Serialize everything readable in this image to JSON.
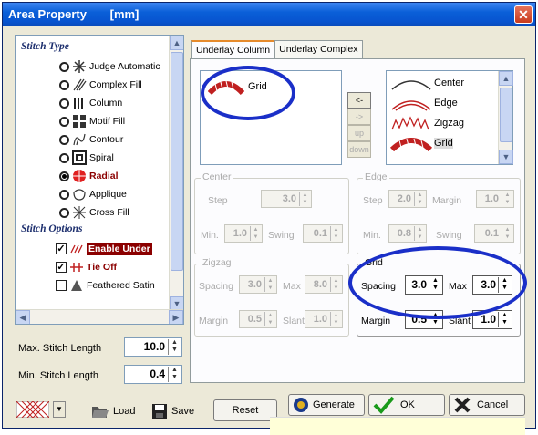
{
  "window": {
    "title": "Area Property",
    "unit": "[mm]",
    "close_label": "✕"
  },
  "stitch_list": {
    "section_type": "Stitch Type",
    "section_options": "Stitch Options",
    "types": [
      {
        "label": "Judge Automatic",
        "selected": false
      },
      {
        "label": "Complex Fill",
        "selected": false
      },
      {
        "label": "Column",
        "selected": false
      },
      {
        "label": "Motif Fill",
        "selected": false
      },
      {
        "label": "Contour",
        "selected": false
      },
      {
        "label": "Spiral",
        "selected": false
      },
      {
        "label": "Radial",
        "selected": true
      },
      {
        "label": "Applique",
        "selected": false
      },
      {
        "label": "Cross Fill",
        "selected": false
      }
    ],
    "options": [
      {
        "label": "Enable Under",
        "checked": true
      },
      {
        "label": "Tie Off",
        "checked": true
      },
      {
        "label": "Feathered Satin",
        "checked": false
      }
    ]
  },
  "fields": {
    "max_stitch_label": "Max. Stitch Length",
    "max_stitch_value": "10.0",
    "min_stitch_label": "Min. Stitch Length",
    "min_stitch_value": "0.4"
  },
  "tabs": [
    "Underlay Column",
    "Underlay Complex"
  ],
  "underlay": {
    "selected_items": [
      "Grid"
    ],
    "available_items": [
      "Center",
      "Edge",
      "Zigzag",
      "Grid"
    ],
    "move_buttons": [
      "<-",
      "->",
      "up",
      "down"
    ]
  },
  "center": {
    "title": "Center",
    "step_label": "Step",
    "step": "3.0",
    "min_label": "Min.",
    "min": "1.0",
    "swing_label": "Swing",
    "swing": "0.1"
  },
  "edge": {
    "title": "Edge",
    "step_label": "Step",
    "step": "2.0",
    "margin_label": "Margin",
    "margin": "1.0",
    "min_label": "Min.",
    "min": "0.8",
    "swing_label": "Swing",
    "swing": "0.1"
  },
  "zigzag": {
    "title": "Zigzag",
    "spacing_label": "Spacing",
    "spacing": "3.0",
    "max_label": "Max",
    "max": "8.0",
    "margin_label": "Margin",
    "margin": "0.5",
    "slant_label": "Slant",
    "slant": "1.0"
  },
  "grid": {
    "title": "Grid",
    "spacing_label": "Spacing",
    "spacing": "3.0",
    "max_label": "Max",
    "max": "3.0",
    "margin_label": "Margin",
    "margin": "0.5",
    "slant_label": "Slant",
    "slant": "1.0"
  },
  "toolbar": {
    "load": "Load",
    "save": "Save",
    "reset": "Reset",
    "generate": "Generate",
    "ok": "OK",
    "cancel": "Cancel"
  },
  "colors": {
    "annotation": "#1a2fc8",
    "highlight": "#8b0000",
    "titlebar": "#0a5fd8"
  }
}
